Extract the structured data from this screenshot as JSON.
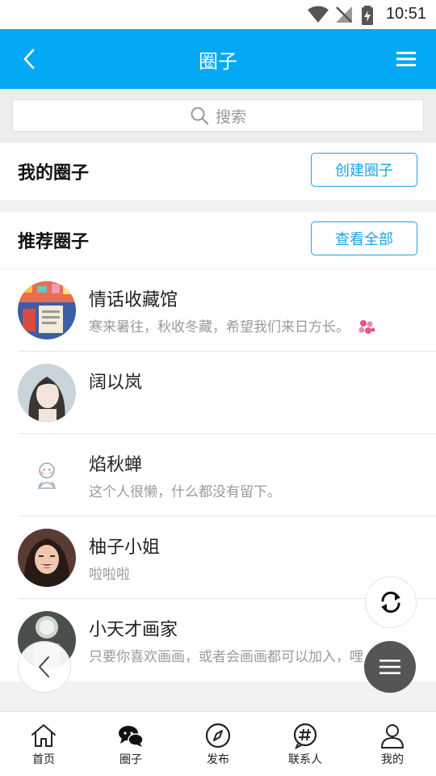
{
  "status_bar": {
    "time": "10:51"
  },
  "app_bar": {
    "title": "圈子"
  },
  "search": {
    "placeholder": "搜索"
  },
  "my_circles": {
    "title": "我的圈子",
    "button": "创建圈子"
  },
  "recommended": {
    "title": "推荐圈子",
    "button": "查看全部"
  },
  "circles": [
    {
      "name": "情话收藏馆",
      "desc": "寒来暑往，秋收冬藏，希望我们来日方长。"
    },
    {
      "name": "阔以岚",
      "desc": ""
    },
    {
      "name": "焰秋蝉",
      "desc": "这个人很懒，什么都没有留下。"
    },
    {
      "name": "柚子小姐",
      "desc": "啦啦啦"
    },
    {
      "name": "小天才画家",
      "desc": "只要你喜欢画画，或者会画画都可以加入，哩"
    }
  ],
  "tabs": [
    {
      "label": "首页",
      "icon": "home-icon"
    },
    {
      "label": "圈子",
      "icon": "chat-bubbles-icon"
    },
    {
      "label": "发布",
      "icon": "compass-icon"
    },
    {
      "label": "联系人",
      "icon": "hashtag-bubble-icon"
    },
    {
      "label": "我的",
      "icon": "person-icon"
    }
  ],
  "colors": {
    "primary": "#03a9f4",
    "button_border": "#1ea4e4",
    "fab_dark": "#555555"
  }
}
